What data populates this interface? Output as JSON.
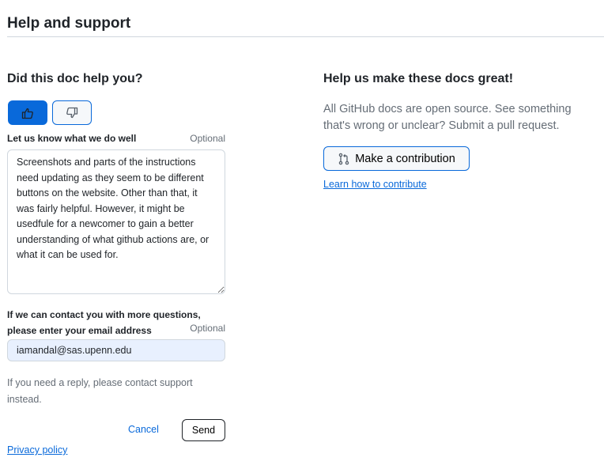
{
  "header": {
    "title": "Help and support"
  },
  "feedback": {
    "title": "Did this doc help you?",
    "thumbs_up_selected": true,
    "well_label": "Let us know what we do well",
    "optional_label": "Optional",
    "well_value": "Screenshots and parts of the instructions need updating as they seem to be different buttons on the website. Other than that, it was fairly helpful. However, it might be usedfule for a newcomer to gain a better understanding of what github actions are, or what it can be used for.",
    "email_label": "If we can contact you with more questions, please enter your email address",
    "email_optional": "Optional",
    "email_value": "iamandal@sas.upenn.edu",
    "note": "If you need a reply, please contact support instead.",
    "cancel": "Cancel",
    "send": "Send",
    "privacy": "Privacy policy",
    "accent": "#0969da"
  },
  "contribute": {
    "title": "Help us make these docs great!",
    "description": "All GitHub docs are open source. See something that's wrong or unclear? Submit a pull request.",
    "button": "Make a contribution",
    "link": "Learn how to contribute"
  }
}
